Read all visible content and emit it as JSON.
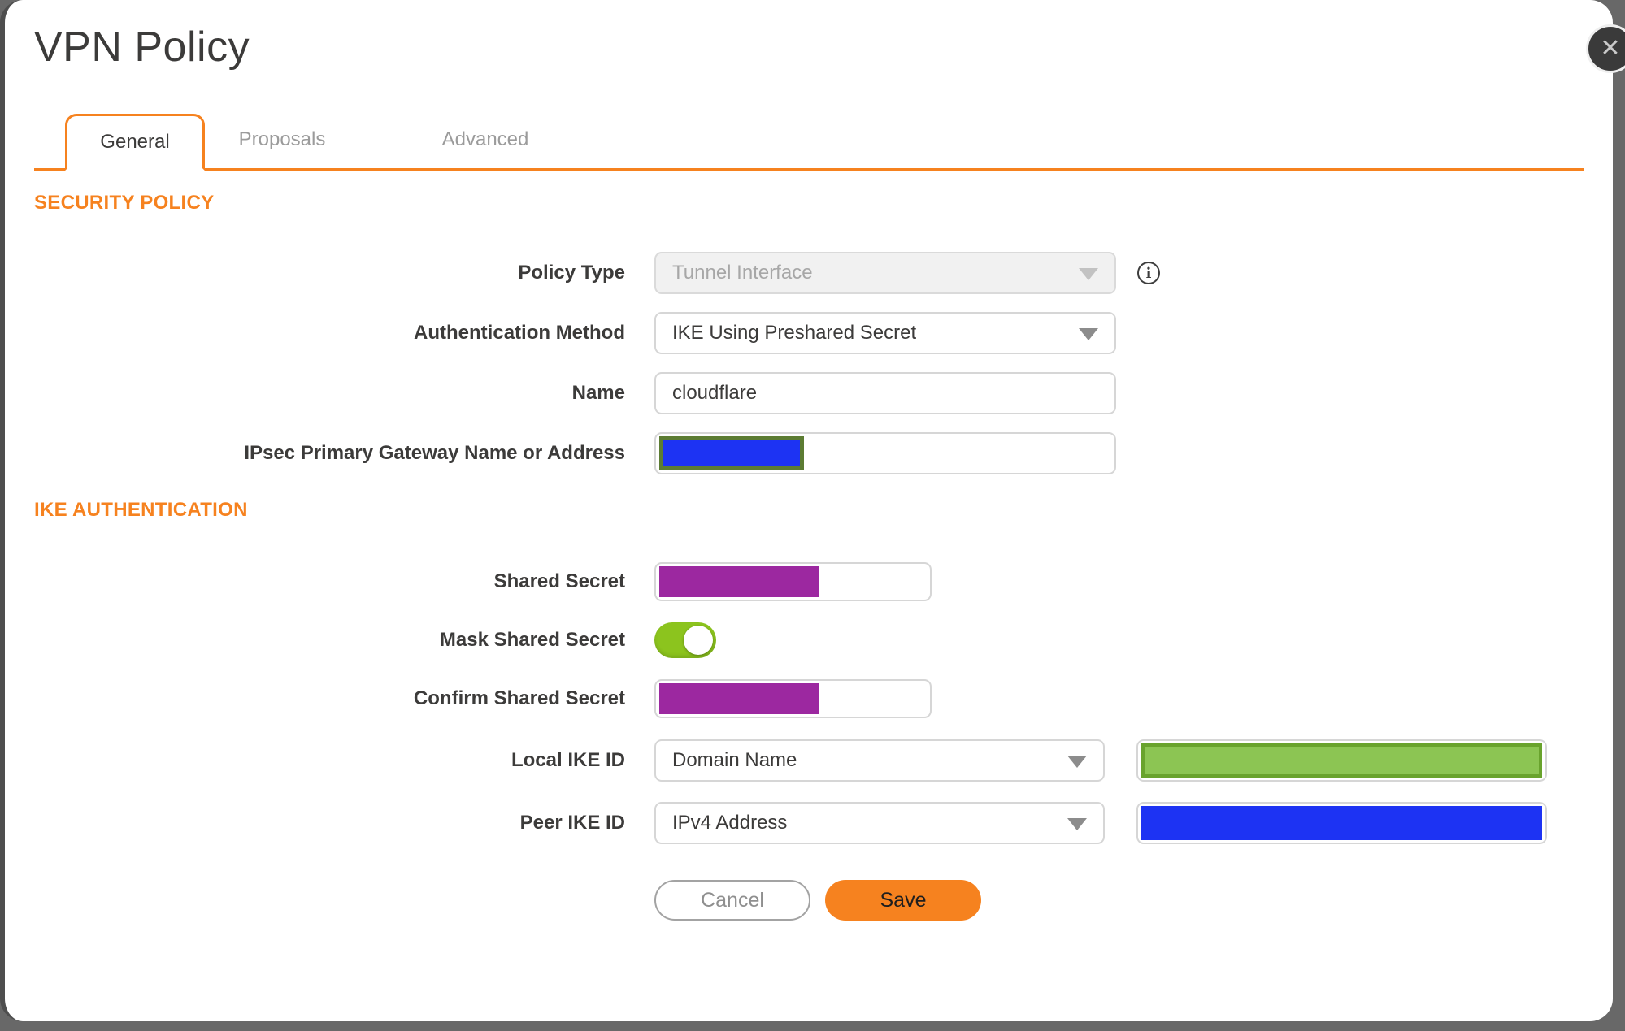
{
  "window": {
    "title": "VPN Policy",
    "close_glyph": "✕"
  },
  "tabs": [
    {
      "label": "General",
      "active": true
    },
    {
      "label": "Proposals",
      "active": false
    },
    {
      "label": "Advanced",
      "active": false
    }
  ],
  "security_policy": {
    "heading": "SECURITY POLICY",
    "policy_type": {
      "label": "Policy Type",
      "value": "Tunnel Interface",
      "disabled": true,
      "info_glyph": "i"
    },
    "auth_method": {
      "label": "Authentication Method",
      "value": "IKE Using Preshared Secret"
    },
    "name": {
      "label": "Name",
      "value": "cloudflare"
    },
    "gateway": {
      "label": "IPsec Primary Gateway Name or Address",
      "value": "",
      "redacted": true
    }
  },
  "ike_authentication": {
    "heading": "IKE AUTHENTICATION",
    "shared_secret": {
      "label": "Shared Secret",
      "redacted": true
    },
    "mask_shared_secret": {
      "label": "Mask Shared Secret",
      "state": "on"
    },
    "confirm_shared_secret": {
      "label": "Confirm Shared Secret",
      "redacted": true
    },
    "local_ike_id": {
      "label": "Local IKE ID",
      "value": "Domain Name",
      "id_value_redacted": true
    },
    "peer_ike_id": {
      "label": "Peer IKE ID",
      "value": "IPv4 Address",
      "id_value_redacted": true
    }
  },
  "footer": {
    "cancel_label": "Cancel",
    "save_label": "Save"
  },
  "colors": {
    "accent_orange": "#f6821f",
    "label_text": "#3c3b3a",
    "inactive_tab_text": "#9b9b9b",
    "redaction_purple": "#9c28a0",
    "redaction_blue": "#1d33f3",
    "redaction_green_fill": "#8cc553",
    "redaction_green_border": "#69a32d",
    "redaction_olive_border": "#5c7c33",
    "toggle_on_green": "#8cc41e",
    "backdrop_gray": "#686868"
  }
}
